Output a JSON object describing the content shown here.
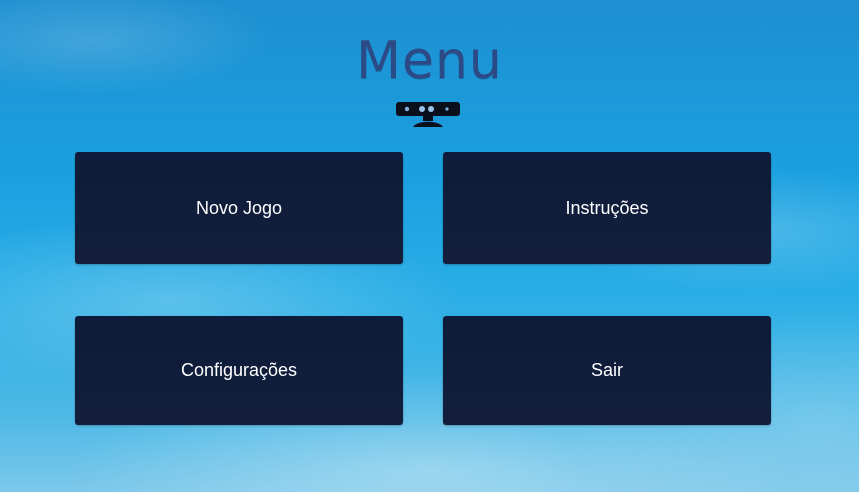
{
  "header": {
    "title": "Menu",
    "logo_icon": "kinect-sensor-icon"
  },
  "menu": {
    "items": [
      {
        "label": "Novo Jogo"
      },
      {
        "label": "Instruções"
      },
      {
        "label": "Configurações"
      },
      {
        "label": "Sair"
      }
    ]
  },
  "colors": {
    "title": "#2b4a86",
    "button_bg": "#0f1f3f",
    "button_text": "#ffffff",
    "sky": "#1aa0e0"
  }
}
